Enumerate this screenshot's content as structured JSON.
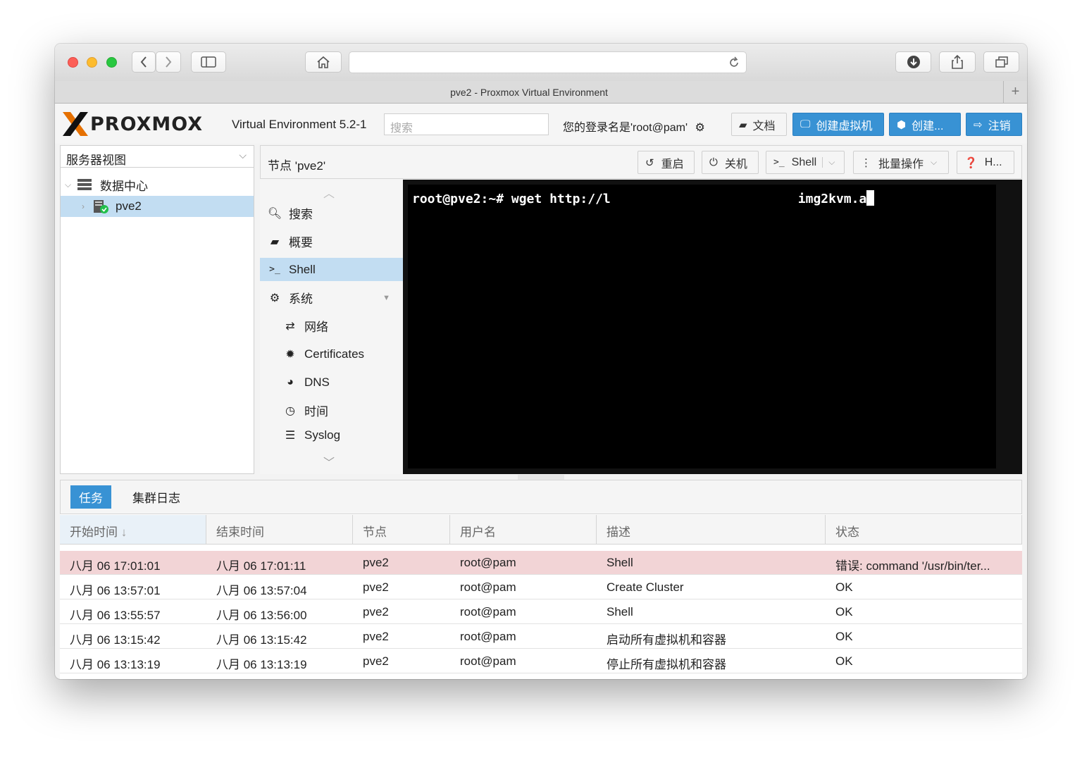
{
  "browser": {
    "tab_title": "pve2 - Proxmox Virtual Environment",
    "new_tab_label": "+"
  },
  "header": {
    "logo_text": "PROXMOX",
    "version": "Virtual Environment 5.2-1",
    "search_placeholder": "搜索",
    "login_text": "您的登录名是'root@pam'",
    "buttons": {
      "docs": "文档",
      "create_vm": "创建虚拟机",
      "create_ct": "创建...",
      "logout": "注销"
    }
  },
  "sidebar": {
    "view_selector": "服务器视图",
    "tree": [
      {
        "label": "数据中心"
      },
      {
        "label": "pve2"
      }
    ]
  },
  "content": {
    "title": "节点 'pve2'",
    "buttons": {
      "reboot": "重启",
      "shutdown": "关机",
      "shell": "Shell",
      "bulk": "批量操作",
      "help": "H..."
    }
  },
  "nav": [
    {
      "label": "搜索",
      "icon": "search-icon"
    },
    {
      "label": "概要",
      "icon": "book-icon"
    },
    {
      "label": "Shell",
      "icon": "terminal-icon"
    },
    {
      "label": "系统",
      "icon": "gears-icon"
    },
    {
      "label": "网络",
      "icon": "exchange-icon"
    },
    {
      "label": "Certificates",
      "icon": "certificate-icon"
    },
    {
      "label": "DNS",
      "icon": "globe-icon"
    },
    {
      "label": "时间",
      "icon": "clock-icon"
    },
    {
      "label": "Syslog",
      "icon": "list-icon"
    }
  ],
  "terminal": {
    "command": "root@pve2:~# wget http://l",
    "command_tail": "img2kvm.a"
  },
  "tasks": {
    "tabs": [
      "任务",
      "集群日志"
    ],
    "columns": [
      "开始时间",
      "结束时间",
      "节点",
      "用户名",
      "描述",
      "状态"
    ],
    "rows": [
      [
        "八月 06 17:01:01",
        "八月 06 17:01:11",
        "pve2",
        "root@pam",
        "Shell",
        "错误: command '/usr/bin/ter..."
      ],
      [
        "八月 06 13:57:01",
        "八月 06 13:57:04",
        "pve2",
        "root@pam",
        "Create Cluster",
        "OK"
      ],
      [
        "八月 06 13:55:57",
        "八月 06 13:56:00",
        "pve2",
        "root@pam",
        "Shell",
        "OK"
      ],
      [
        "八月 06 13:15:42",
        "八月 06 13:15:42",
        "pve2",
        "root@pam",
        "启动所有虚拟机和容器",
        "OK"
      ],
      [
        "八月 06 13:13:19",
        "八月 06 13:13:19",
        "pve2",
        "root@pam",
        "停止所有虚拟机和容器",
        "OK"
      ]
    ]
  },
  "colors": {
    "accent": "#3892d4",
    "selected": "#c2ddf2",
    "error_row": "#f2d4d6",
    "logo_orange": "#e57000"
  }
}
